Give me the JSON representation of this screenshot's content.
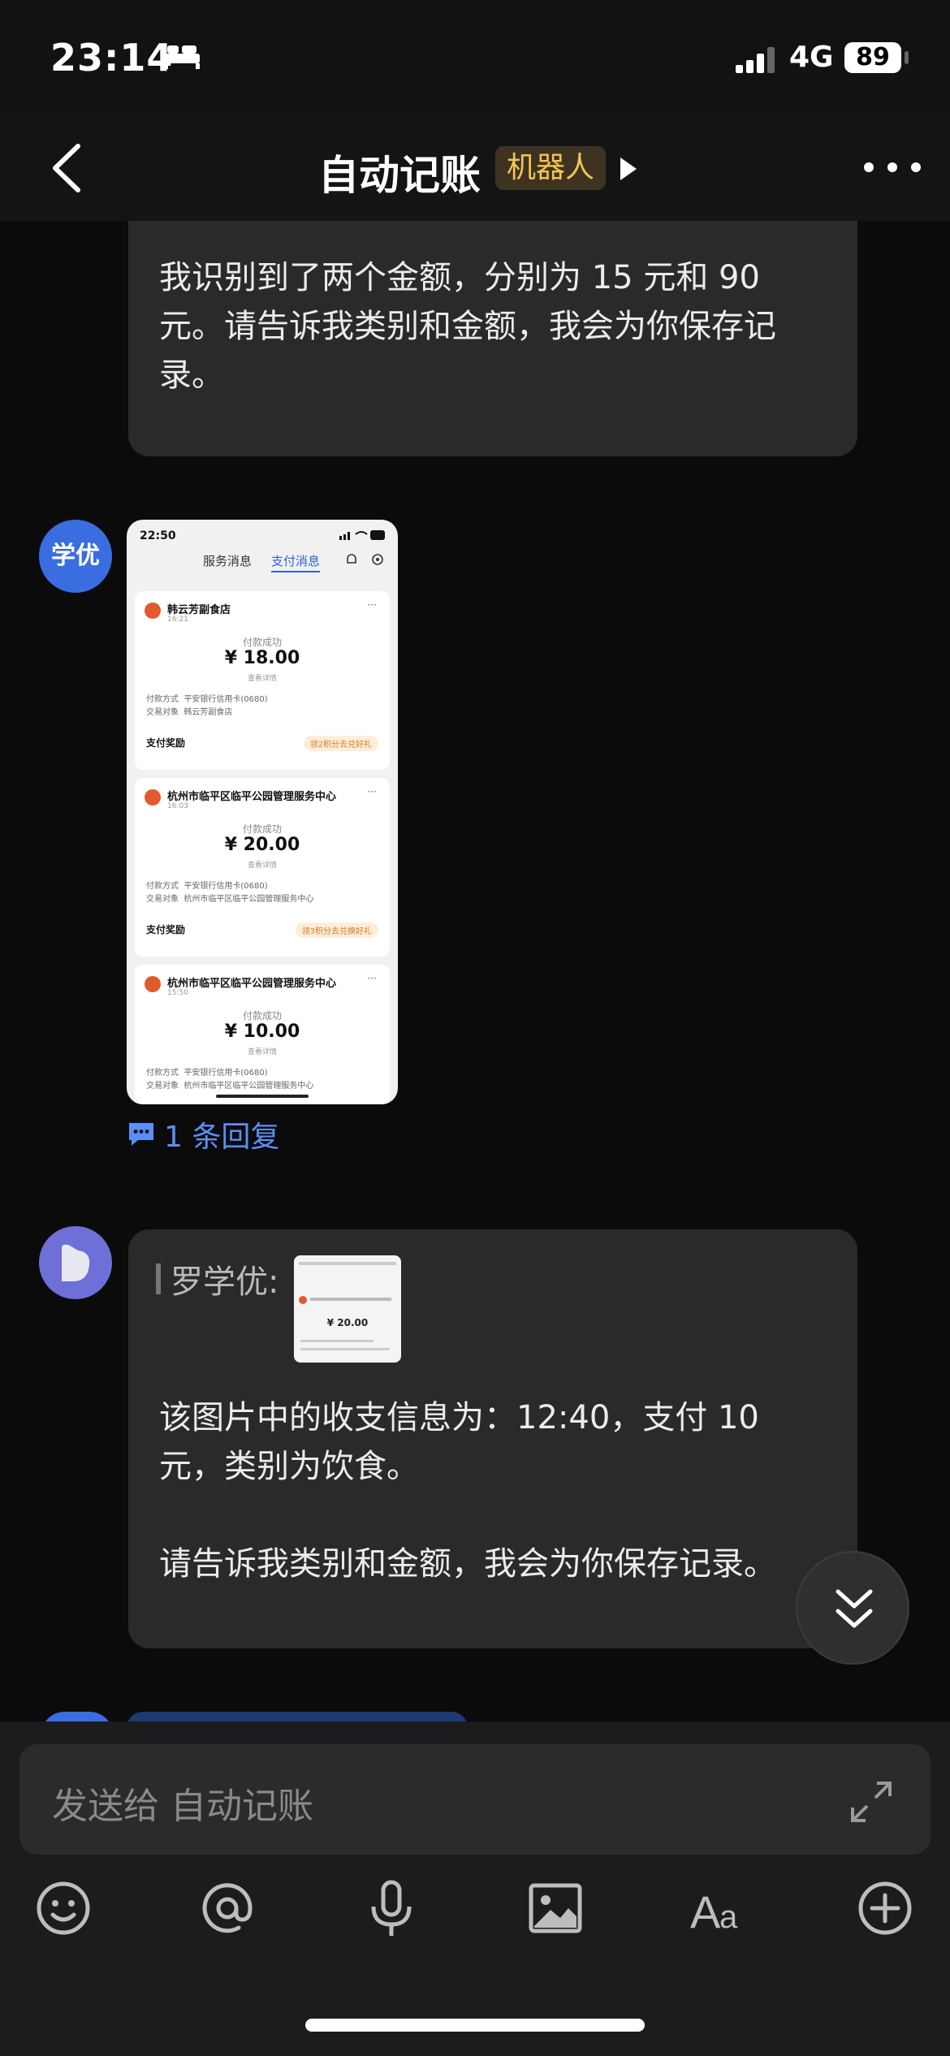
{
  "status_bar": {
    "time": "23:14",
    "network": "4G",
    "battery": "89"
  },
  "nav": {
    "title": "自动记账",
    "tag": "机器人"
  },
  "messages": {
    "bot_reply_1": {
      "lines": [
        "我识别到了两个金额，分别为 15 元和 90",
        "元。请告诉我类别和金额，我会为你保存记",
        "录。"
      ]
    },
    "user_image": {
      "avatar_text": "学优",
      "screenshot": {
        "time": "22:50",
        "battery": "94",
        "tabs": [
          "服务消息",
          "支付消息"
        ],
        "cards": [
          {
            "merchant": "韩云芳副食店",
            "time": "16:21",
            "status": "付款成功",
            "amount": "¥ 18.00",
            "detail": "查看详情",
            "pay_method_label": "付款方式",
            "pay_method": "平安银行信用卡(0680)",
            "counterparty_label": "交易对象",
            "counterparty": "韩云芳副食店",
            "reward_label": "支付奖励",
            "reward_badge": "领2积分去兑好礼"
          },
          {
            "merchant": "杭州市临平区临平公园管理服务中心",
            "time": "16:03",
            "status": "付款成功",
            "amount": "¥ 20.00",
            "detail": "查看详情",
            "pay_method_label": "付款方式",
            "pay_method": "平安银行信用卡(0680)",
            "counterparty_label": "交易对象",
            "counterparty": "杭州市临平区临平公园管理服务中心",
            "reward_label": "支付奖励",
            "reward_badge": "领3积分去兑换好礼"
          },
          {
            "merchant": "杭州市临平区临平公园管理服务中心",
            "time": "15:50",
            "status": "付款成功",
            "amount": "¥ 10.00",
            "detail": "查看详情",
            "pay_method_label": "付款方式",
            "pay_method": "平安银行信用卡(0680)",
            "counterparty_label": "交易对象",
            "counterparty": "杭州市临平区临平公园管理服务中心"
          }
        ]
      },
      "reply_count": "1 条回复"
    },
    "bot_reply_2": {
      "quote_name": "罗学优:",
      "quote_amount": "¥ 20.00",
      "lines": [
        "该图片中的收支信息为：12:40，支付 10",
        "元，类别为饮食。",
        "",
        "请告诉我类别和金额，我会为你保存记录。"
      ]
    }
  },
  "input": {
    "placeholder": "发送给 自动记账"
  },
  "toolbar": [
    "emoji-icon",
    "at-icon",
    "microphone-icon",
    "image-icon",
    "text-format-icon",
    "plus-icon"
  ],
  "colors": {
    "background": "#0b0b0c",
    "bubble": "#2a2a2c",
    "link": "#5b8ff6",
    "tag_bg": "#3d3320",
    "tag_text": "#f4c455"
  }
}
